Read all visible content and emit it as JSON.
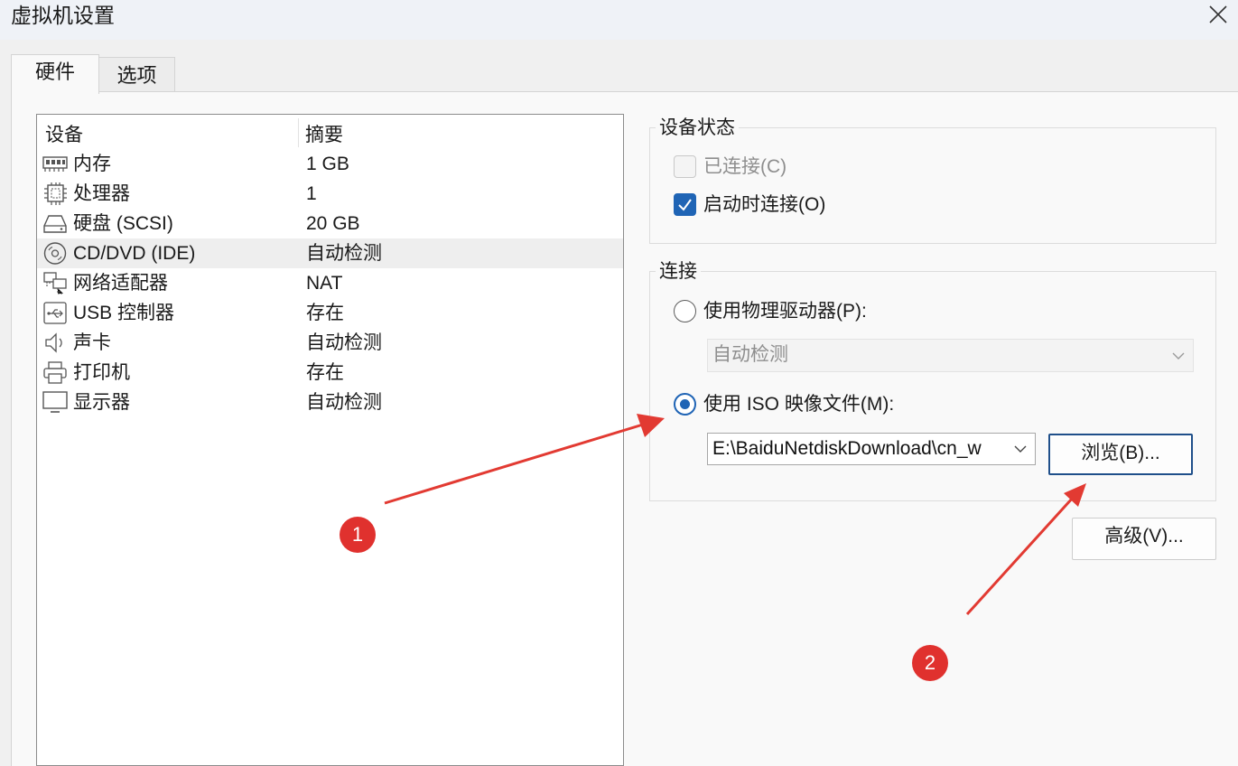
{
  "window": {
    "title": "虚拟机设置"
  },
  "tabs": [
    {
      "label": "硬件",
      "selected": true
    },
    {
      "label": "选项",
      "selected": false
    }
  ],
  "device_list": {
    "columns": [
      "设备",
      "摘要"
    ],
    "rows": [
      {
        "icon": "memory-icon",
        "name": "内存",
        "summary": "1 GB"
      },
      {
        "icon": "processor-icon",
        "name": "处理器",
        "summary": "1"
      },
      {
        "icon": "hard-disk-icon",
        "name": "硬盘 (SCSI)",
        "summary": "20 GB"
      },
      {
        "icon": "cd-dvd-icon",
        "name": "CD/DVD (IDE)",
        "summary": "自动检测",
        "selected": true
      },
      {
        "icon": "network-adapter-icon",
        "name": "网络适配器",
        "summary": "NAT"
      },
      {
        "icon": "usb-icon",
        "name": "USB 控制器",
        "summary": "存在"
      },
      {
        "icon": "sound-icon",
        "name": "声卡",
        "summary": "自动检测"
      },
      {
        "icon": "printer-icon",
        "name": "打印机",
        "summary": "存在"
      },
      {
        "icon": "display-icon",
        "name": "显示器",
        "summary": "自动检测"
      }
    ]
  },
  "device_status": {
    "label": "设备状态",
    "connected": {
      "label": "已连接(C)",
      "checked": false,
      "enabled": false
    },
    "connect_at_power_on": {
      "label": "启动时连接(O)",
      "checked": true,
      "enabled": true
    }
  },
  "connection": {
    "label": "连接",
    "physical_drive": {
      "label": "使用物理驱动器(P):",
      "selected": false,
      "value": "自动检测"
    },
    "iso_image": {
      "label": "使用 ISO 映像文件(M):",
      "selected": true,
      "value": "E:\\BaiduNetdiskDownload\\cn_w"
    },
    "browse_label": "浏览(B)..."
  },
  "advanced_label": "高级(V)...",
  "annotations": [
    {
      "number": "1"
    },
    {
      "number": "2"
    }
  ],
  "colors": {
    "accent": "#1f64b5",
    "annotation": "#e0312e"
  }
}
